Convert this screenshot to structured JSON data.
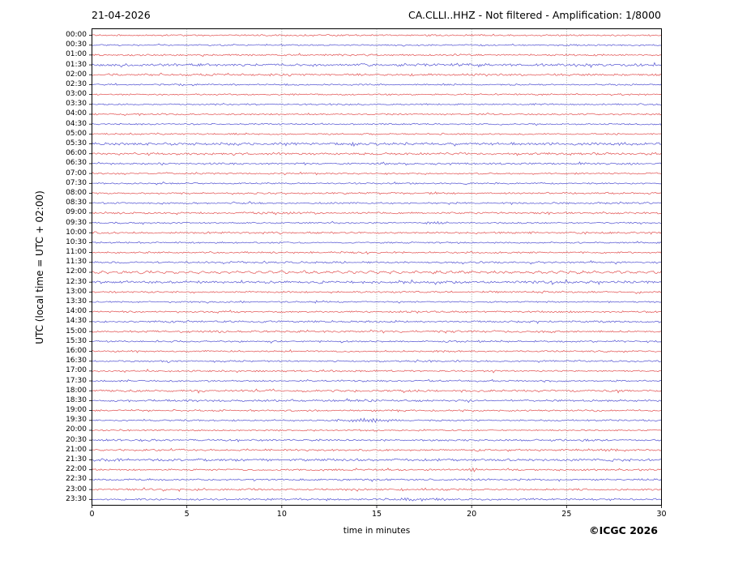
{
  "header": {
    "date": "21-04-2026",
    "title": "CA.CLLI..HHZ - Not filtered - Amplification: 1/8000"
  },
  "footer": {
    "copyright": "©ICGC 2026"
  },
  "chart_data": {
    "type": "line",
    "subtype": "helicorder-daily-seismogram",
    "title": "CA.CLLI..HHZ - Not filtered - Amplification: 1/8000",
    "date": "21-04-2026",
    "station": "CA.CLLI..HHZ",
    "filter": "Not filtered",
    "amplification": "1/8000",
    "xlabel": "time in minutes",
    "ylabel": "UTC (local time = UTC + 02:00)",
    "xlim": [
      0,
      30
    ],
    "x_ticks": [
      0,
      5,
      10,
      15,
      20,
      25,
      30
    ],
    "minutes_per_row": 30,
    "grid": {
      "vertical_dotted_at_minutes": [
        5,
        10,
        15,
        20,
        25
      ]
    },
    "colors": {
      "hour_trace": "#e25050",
      "half_hour_trace": "#5252d2",
      "grid": "#888888",
      "frame": "#000000"
    },
    "rows": [
      {
        "label": "00:00",
        "color": "red",
        "amp": 0.75
      },
      {
        "label": "00:30",
        "color": "blue",
        "amp": 0.7
      },
      {
        "label": "01:00",
        "color": "red",
        "amp": 0.85
      },
      {
        "label": "01:30",
        "color": "blue",
        "amp": 1.25
      },
      {
        "label": "02:00",
        "color": "red",
        "amp": 1.0
      },
      {
        "label": "02:30",
        "color": "blue",
        "amp": 0.7,
        "events": [
          {
            "min": 4.6,
            "sigma": 0.2,
            "amp": 1.0
          }
        ]
      },
      {
        "label": "03:00",
        "color": "red",
        "amp": 0.7
      },
      {
        "label": "03:30",
        "color": "blue",
        "amp": 0.75
      },
      {
        "label": "04:00",
        "color": "red",
        "amp": 0.75
      },
      {
        "label": "04:30",
        "color": "blue",
        "amp": 0.7
      },
      {
        "label": "05:00",
        "color": "red",
        "amp": 0.75
      },
      {
        "label": "05:30",
        "color": "blue",
        "amp": 1.3
      },
      {
        "label": "06:00",
        "color": "red",
        "amp": 1.05
      },
      {
        "label": "06:30",
        "color": "blue",
        "amp": 0.85
      },
      {
        "label": "07:00",
        "color": "red",
        "amp": 0.75
      },
      {
        "label": "07:30",
        "color": "blue",
        "amp": 0.7
      },
      {
        "label": "08:00",
        "color": "red",
        "amp": 0.8
      },
      {
        "label": "08:30",
        "color": "blue",
        "amp": 0.8
      },
      {
        "label": "09:00",
        "color": "red",
        "amp": 0.9
      },
      {
        "label": "09:30",
        "color": "blue",
        "amp": 0.7,
        "events": [
          {
            "min": 18.0,
            "sigma": 0.5,
            "amp": 1.1
          }
        ]
      },
      {
        "label": "10:00",
        "color": "red",
        "amp": 0.85
      },
      {
        "label": "10:30",
        "color": "blue",
        "amp": 0.7
      },
      {
        "label": "11:00",
        "color": "red",
        "amp": 0.8,
        "events": [
          {
            "min": 20.0,
            "sigma": 0.3,
            "amp": 0.9
          }
        ]
      },
      {
        "label": "11:30",
        "color": "blue",
        "amp": 0.9
      },
      {
        "label": "12:00",
        "color": "red",
        "amp": 0.9,
        "wave": true
      },
      {
        "label": "12:30",
        "color": "blue",
        "amp": 1.2
      },
      {
        "label": "13:00",
        "color": "red",
        "amp": 0.8
      },
      {
        "label": "13:30",
        "color": "blue",
        "amp": 0.7
      },
      {
        "label": "14:00",
        "color": "red",
        "amp": 0.8
      },
      {
        "label": "14:30",
        "color": "blue",
        "amp": 0.9
      },
      {
        "label": "15:00",
        "color": "red",
        "amp": 1.0
      },
      {
        "label": "15:30",
        "color": "blue",
        "amp": 0.8
      },
      {
        "label": "16:00",
        "color": "red",
        "amp": 0.8
      },
      {
        "label": "16:30",
        "color": "blue",
        "amp": 0.8
      },
      {
        "label": "17:00",
        "color": "red",
        "amp": 0.8
      },
      {
        "label": "17:30",
        "color": "blue",
        "amp": 0.8
      },
      {
        "label": "18:00",
        "color": "red",
        "amp": 0.95
      },
      {
        "label": "18:30",
        "color": "blue",
        "amp": 0.95
      },
      {
        "label": "19:00",
        "color": "red",
        "amp": 0.8
      },
      {
        "label": "19:30",
        "color": "blue",
        "amp": 0.75,
        "events": [
          {
            "min": 14.6,
            "sigma": 1.1,
            "amp": 1.9
          }
        ]
      },
      {
        "label": "20:00",
        "color": "red",
        "amp": 0.7
      },
      {
        "label": "20:30",
        "color": "blue",
        "amp": 0.9
      },
      {
        "label": "21:00",
        "color": "red",
        "amp": 0.9,
        "events": [
          {
            "min": 27.2,
            "sigma": 0.7,
            "amp": 1.1
          }
        ]
      },
      {
        "label": "21:30",
        "color": "blue",
        "amp": 1.15
      },
      {
        "label": "22:00",
        "color": "red",
        "amp": 0.8,
        "events": [
          {
            "min": 20.1,
            "sigma": 0.15,
            "amp": 1.7
          }
        ]
      },
      {
        "label": "22:30",
        "color": "blue",
        "amp": 0.8
      },
      {
        "label": "23:00",
        "color": "red",
        "amp": 0.9
      },
      {
        "label": "23:30",
        "color": "blue",
        "amp": 0.9,
        "events": [
          {
            "min": 17.2,
            "sigma": 1.2,
            "amp": 1.2
          }
        ]
      }
    ]
  }
}
